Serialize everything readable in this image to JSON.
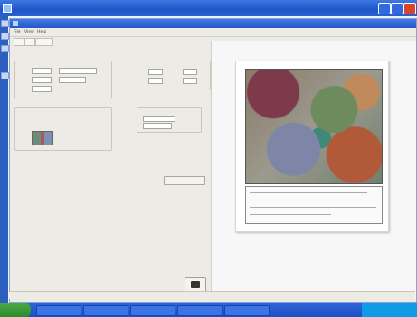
{
  "window": {
    "title": "",
    "dialog_title": ""
  },
  "menu": {
    "items": [
      "File",
      "View",
      "Help"
    ]
  },
  "groups": {
    "layout": "",
    "map_area": "",
    "legend": "",
    "output": ""
  },
  "labels": {
    "orientation": "",
    "size": "",
    "scale": "",
    "landscape": "",
    "portrait": ""
  },
  "generate_button": {
    "label": ""
  },
  "status": {
    "left": "",
    "mid": ""
  },
  "taskbar": {
    "clock": ""
  },
  "icons": [
    "app-icon",
    "minimize-icon",
    "maximize-icon",
    "close-icon",
    "print-icon",
    "start-button-icon"
  ],
  "colors": {
    "title_bar": "#1f55c8",
    "close_button": "#d8452b",
    "taskbar": "#2e63d8",
    "start": "#2f8a2e"
  }
}
